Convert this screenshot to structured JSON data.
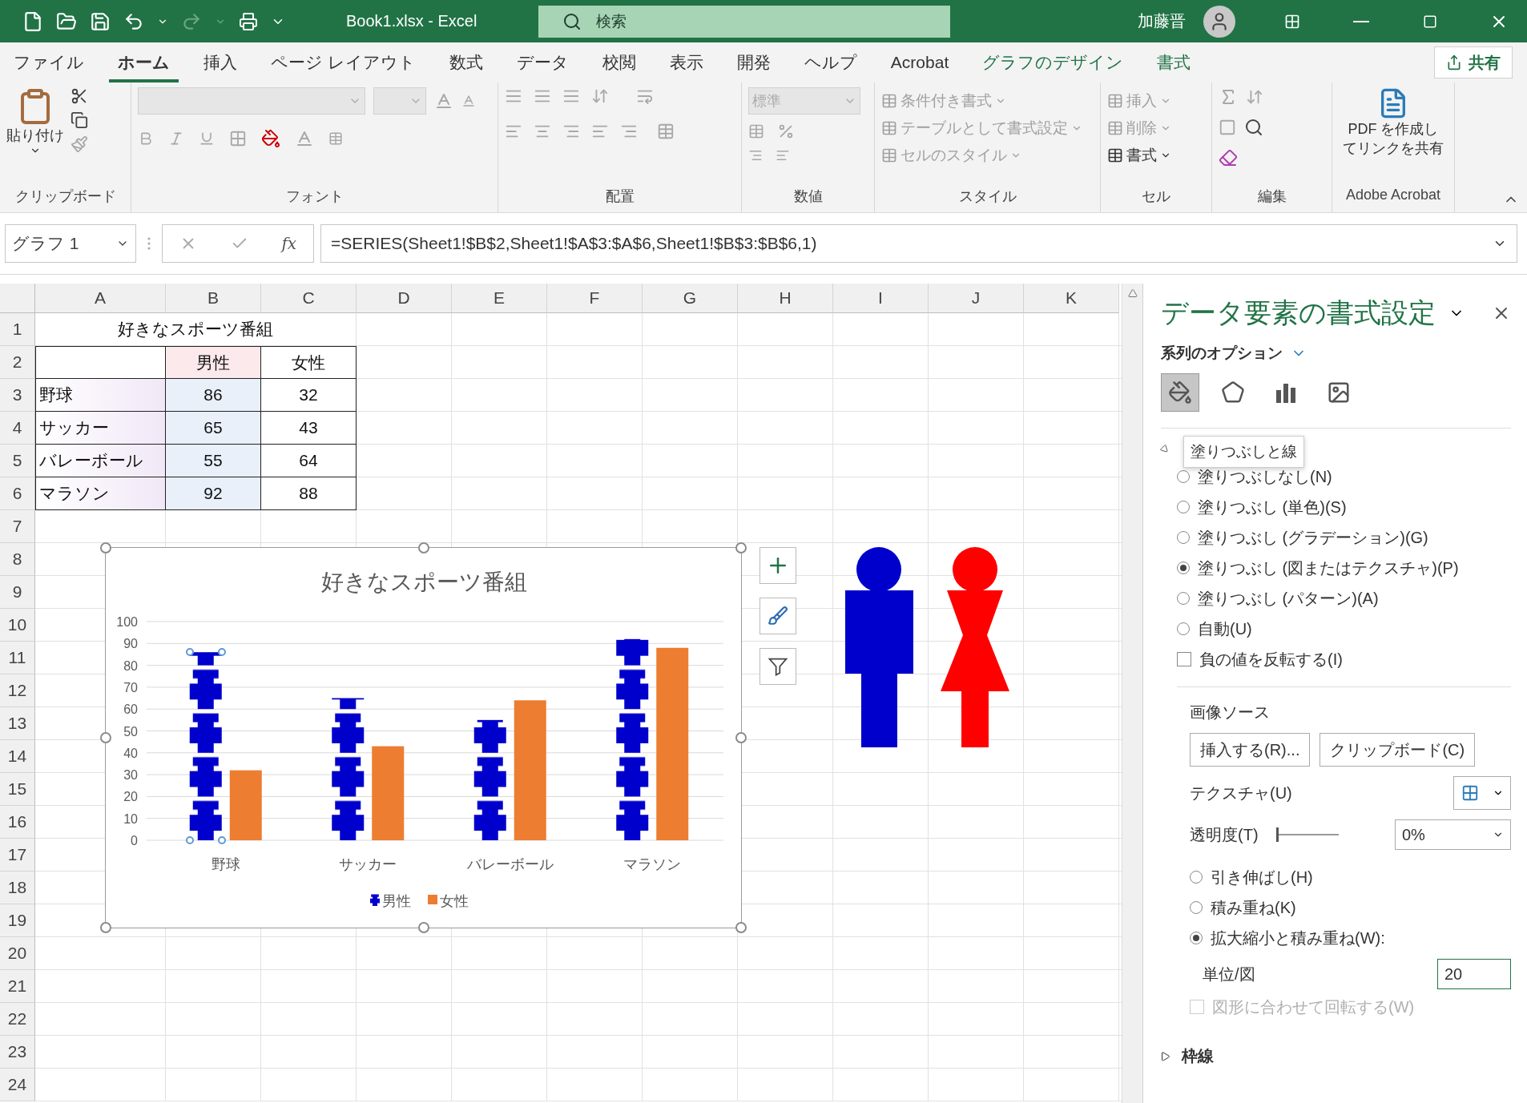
{
  "title_bar": {
    "title": "Book1.xlsx  -  Excel",
    "search": {
      "placeholder": "検索"
    },
    "user": "加藤晋"
  },
  "tabs": [
    {
      "label": "ファイル",
      "selected": false,
      "kind": "normal"
    },
    {
      "label": "ホーム",
      "selected": true,
      "kind": "normal"
    },
    {
      "label": "挿入",
      "selected": false,
      "kind": "normal"
    },
    {
      "label": "ページ レイアウト",
      "selected": false,
      "kind": "normal"
    },
    {
      "label": "数式",
      "selected": false,
      "kind": "normal"
    },
    {
      "label": "データ",
      "selected": false,
      "kind": "normal"
    },
    {
      "label": "校閲",
      "selected": false,
      "kind": "normal"
    },
    {
      "label": "表示",
      "selected": false,
      "kind": "normal"
    },
    {
      "label": "開発",
      "selected": false,
      "kind": "normal"
    },
    {
      "label": "ヘルプ",
      "selected": false,
      "kind": "normal"
    },
    {
      "label": "Acrobat",
      "selected": false,
      "kind": "normal"
    },
    {
      "label": "グラフのデザイン",
      "selected": false,
      "kind": "contextual"
    },
    {
      "label": "書式",
      "selected": false,
      "kind": "contextual"
    }
  ],
  "share_button": "共有",
  "ribbon": {
    "clipboard": {
      "paste": "貼り付け",
      "label": "クリップボード"
    },
    "font": {
      "label": "フォント"
    },
    "alignment": {
      "label": "配置"
    },
    "number": {
      "format": "標準",
      "label": "数値"
    },
    "styles": {
      "items": [
        {
          "label": "条件付き書式",
          "disabled": true
        },
        {
          "label": "テーブルとして書式設定",
          "disabled": true
        },
        {
          "label": "セルのスタイル",
          "disabled": true
        }
      ],
      "label": "スタイル"
    },
    "cells": {
      "items": [
        {
          "label": "挿入",
          "disabled": true
        },
        {
          "label": "削除",
          "disabled": true
        },
        {
          "label": "書式",
          "disabled": false
        }
      ],
      "label": "セル"
    },
    "editing": {
      "label": "編集"
    },
    "acrobat": {
      "button_lines": [
        "PDF を作成し",
        "てリンクを共有"
      ],
      "label": "Adobe Acrobat"
    }
  },
  "formula_bar": {
    "name_box": "グラフ 1",
    "function_button": "fx",
    "formula": "=SERIES(Sheet1!$B$2,Sheet1!$A$3:$A$6,Sheet1!$B$3:$B$6,1)"
  },
  "sheet": {
    "columns": [
      "A",
      "B",
      "C",
      "D",
      "E",
      "F",
      "G",
      "H",
      "I",
      "J",
      "K"
    ],
    "rows": [
      "1",
      "2",
      "3",
      "4",
      "5",
      "6",
      "7",
      "8",
      "9",
      "10",
      "11",
      "12",
      "13",
      "14",
      "15",
      "16",
      "17",
      "18",
      "19",
      "20",
      "21",
      "22",
      "23",
      "24"
    ],
    "table": {
      "title": "好きなスポーツ番組",
      "header": [
        "男性",
        "女性"
      ],
      "rows": [
        {
          "label": "野球",
          "values": [
            "86",
            "32"
          ]
        },
        {
          "label": "サッカー",
          "values": [
            "65",
            "43"
          ]
        },
        {
          "label": "バレーボール",
          "values": [
            "55",
            "64"
          ]
        },
        {
          "label": "マラソン",
          "values": [
            "92",
            "88"
          ]
        }
      ]
    }
  },
  "chart": {
    "chart_data": {
      "type": "bar",
      "title": "好きなスポーツ番組",
      "categories": [
        "野球",
        "サッカー",
        "バレーボール",
        "マラソン"
      ],
      "series": [
        {
          "name": "男性",
          "color": "#0000cc",
          "values": [
            86,
            65,
            55,
            92
          ]
        },
        {
          "name": "女性",
          "color": "#ed7d31",
          "values": [
            32,
            43,
            64,
            88
          ]
        }
      ],
      "grid": true,
      "legend": "bottom",
      "ylim": [
        0,
        100
      ],
      "yticks": [
        0,
        10,
        20,
        30,
        40,
        50,
        60,
        70,
        80,
        90,
        100
      ]
    },
    "series_styles": [
      {
        "kind": "picture"
      },
      {
        "kind": "solid"
      }
    ],
    "point_selected": [
      true,
      false,
      false,
      false
    ]
  },
  "format_panel": {
    "title": "データ要素の書式設定",
    "options_label": "系列のオプション",
    "icon_tabs": [
      {
        "selected": true
      },
      {
        "selected": false
      },
      {
        "selected": false
      },
      {
        "selected": false
      }
    ],
    "tooltip": "塗りつぶしと線",
    "fill_options": [
      {
        "label": "塗りつぶしなし(N)",
        "selected": false
      },
      {
        "label": "塗りつぶし (単色)(S)",
        "selected": false
      },
      {
        "label": "塗りつぶし (グラデーション)(G)",
        "selected": false
      },
      {
        "label": "塗りつぶし (図またはテクスチャ)(P)",
        "selected": true
      },
      {
        "label": "塗りつぶし (パターン)(A)",
        "selected": false
      },
      {
        "label": "自動(U)",
        "selected": false
      }
    ],
    "invert": {
      "label": "負の値を反転する(I)",
      "checked": false
    },
    "image_source": {
      "label": "画像ソース",
      "buttons": [
        "挿入する(R)...",
        "クリップボード(C)"
      ]
    },
    "texture": {
      "label": "テクスチャ(U)"
    },
    "transparency": {
      "label": "透明度(T)",
      "level": 0,
      "reading": "0%"
    },
    "layout_options": [
      {
        "label": "引き伸ばし(H)",
        "selected": false
      },
      {
        "label": "積み重ね(K)",
        "selected": false
      },
      {
        "label": "拡大縮小と積み重ね(W):",
        "selected": true
      }
    ],
    "unit": {
      "label": "単位/図",
      "value": "20"
    },
    "rotate": {
      "label": "図形に合わせて回転する(W)",
      "checked": false,
      "disabled": true
    },
    "border_section": {
      "label": "枠線",
      "expanded": false
    }
  }
}
